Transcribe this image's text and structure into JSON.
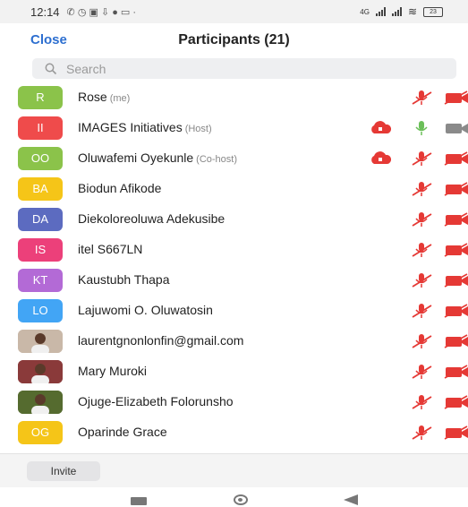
{
  "status_bar": {
    "time": "12:14",
    "battery": "23",
    "network": "4G"
  },
  "header": {
    "close_label": "Close",
    "title": "Participants (21)"
  },
  "search": {
    "placeholder": "Search"
  },
  "participants": [
    {
      "initials": "R",
      "name": "Rose",
      "role": "(me)",
      "color": "#8bc34a",
      "photo": false,
      "cloud": false,
      "mic": "muted",
      "cam": "off"
    },
    {
      "initials": "II",
      "name": "IMAGES Initiatives",
      "role": "(Host)",
      "color": "#ef4b4b",
      "photo": false,
      "cloud": true,
      "mic": "on",
      "cam": "on"
    },
    {
      "initials": "OO",
      "name": "Oluwafemi Oyekunle",
      "role": "(Co-host)",
      "color": "#8bc34a",
      "photo": false,
      "cloud": true,
      "mic": "muted",
      "cam": "off"
    },
    {
      "initials": "BA",
      "name": "Biodun Afikode",
      "role": "",
      "color": "#f5c518",
      "photo": false,
      "cloud": false,
      "mic": "muted",
      "cam": "off"
    },
    {
      "initials": "DA",
      "name": "Diekoloreoluwa Adekusibe",
      "role": "",
      "color": "#5c6bc0",
      "photo": false,
      "cloud": false,
      "mic": "muted",
      "cam": "off"
    },
    {
      "initials": "IS",
      "name": "itel S667LN",
      "role": "",
      "color": "#ec407a",
      "photo": false,
      "cloud": false,
      "mic": "muted",
      "cam": "off"
    },
    {
      "initials": "KT",
      "name": "Kaustubh Thapa",
      "role": "",
      "color": "#b36ad6",
      "photo": false,
      "cloud": false,
      "mic": "muted",
      "cam": "off"
    },
    {
      "initials": "LO",
      "name": "Lajuwomi O. Oluwatosin",
      "role": "",
      "color": "#42a5f5",
      "photo": false,
      "cloud": false,
      "mic": "muted",
      "cam": "off"
    },
    {
      "initials": "",
      "name": "laurentgnonlonfin@gmail.com",
      "role": "",
      "color": "#c9b8a8",
      "photo": true,
      "cloud": false,
      "mic": "muted",
      "cam": "off"
    },
    {
      "initials": "",
      "name": "Mary Muroki",
      "role": "",
      "color": "#8a3a3a",
      "photo": true,
      "cloud": false,
      "mic": "muted",
      "cam": "off"
    },
    {
      "initials": "",
      "name": "Ojuge-Elizabeth Folorunsho",
      "role": "",
      "color": "#556b2f",
      "photo": true,
      "cloud": false,
      "mic": "muted",
      "cam": "off"
    },
    {
      "initials": "OG",
      "name": "Oparinde Grace",
      "role": "",
      "color": "#f5c518",
      "photo": false,
      "cloud": false,
      "mic": "muted",
      "cam": "off"
    }
  ],
  "footer": {
    "invite_label": "Invite"
  },
  "colors": {
    "accent": "#2d6fd0",
    "muted_red": "#e53935",
    "mic_green": "#6bbf59"
  }
}
